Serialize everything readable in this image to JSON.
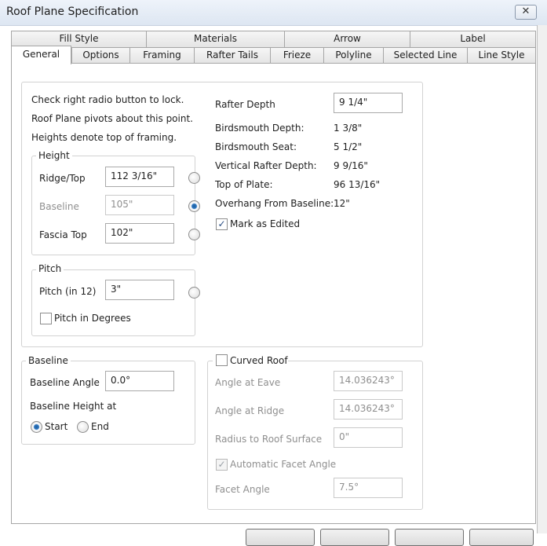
{
  "window": {
    "title": "Roof Plane Specification"
  },
  "tabs_back": [
    "Fill Style",
    "Materials",
    "Arrow",
    "Label"
  ],
  "tabs_front": [
    "General",
    "Options",
    "Framing",
    "Rafter Tails",
    "Frieze",
    "Polyline",
    "Selected Line",
    "Line Style"
  ],
  "selected_tab": "General",
  "instructions": [
    "Check right radio button to lock.",
    "Roof Plane pivots about this point.",
    "Heights denote top of framing."
  ],
  "height_group": {
    "title": "Height",
    "ridge_label": "Ridge/Top",
    "ridge_value": "112 3/16\"",
    "baseline_label": "Baseline",
    "baseline_value": "105\"",
    "fascia_label": "Fascia Top",
    "fascia_value": "102\"",
    "locked": "Baseline"
  },
  "pitch_group": {
    "title": "Pitch",
    "pitch_label": "Pitch (in 12)",
    "pitch_value": "3\"",
    "degrees_label": "Pitch in Degrees",
    "degrees_checked": false
  },
  "rafter": {
    "depth_label": "Rafter Depth",
    "depth_value": "9 1/4\"",
    "bm_depth_label": "Birdsmouth Depth:",
    "bm_depth_value": "1 3/8\"",
    "bm_seat_label": "Birdsmouth Seat:",
    "bm_seat_value": "5 1/2\"",
    "vert_label": "Vertical Rafter Depth:",
    "vert_value": "9 9/16\"",
    "plate_label": "Top of Plate:",
    "plate_value": "96 13/16\"",
    "overhang_label": "Overhang From Baseline:",
    "overhang_value": "12\"",
    "mark_label": "Mark as Edited",
    "mark_checked": true
  },
  "baseline_group": {
    "title": "Baseline",
    "angle_label": "Baseline Angle",
    "angle_value": "0.0°",
    "height_at_label": "Baseline Height at",
    "start_label": "Start",
    "end_label": "End",
    "selected": "Start"
  },
  "curved_group": {
    "title": "Curved Roof",
    "checked": false,
    "eave_label": "Angle at Eave",
    "eave_value": "14.036243°",
    "ridge_label": "Angle at Ridge",
    "ridge_value": "14.036243°",
    "radius_label": "Radius to Roof Surface",
    "radius_value": "0\"",
    "auto_label": "Automatic Facet Angle",
    "auto_checked": true,
    "facet_label": "Facet Angle",
    "facet_value": "7.5°"
  }
}
